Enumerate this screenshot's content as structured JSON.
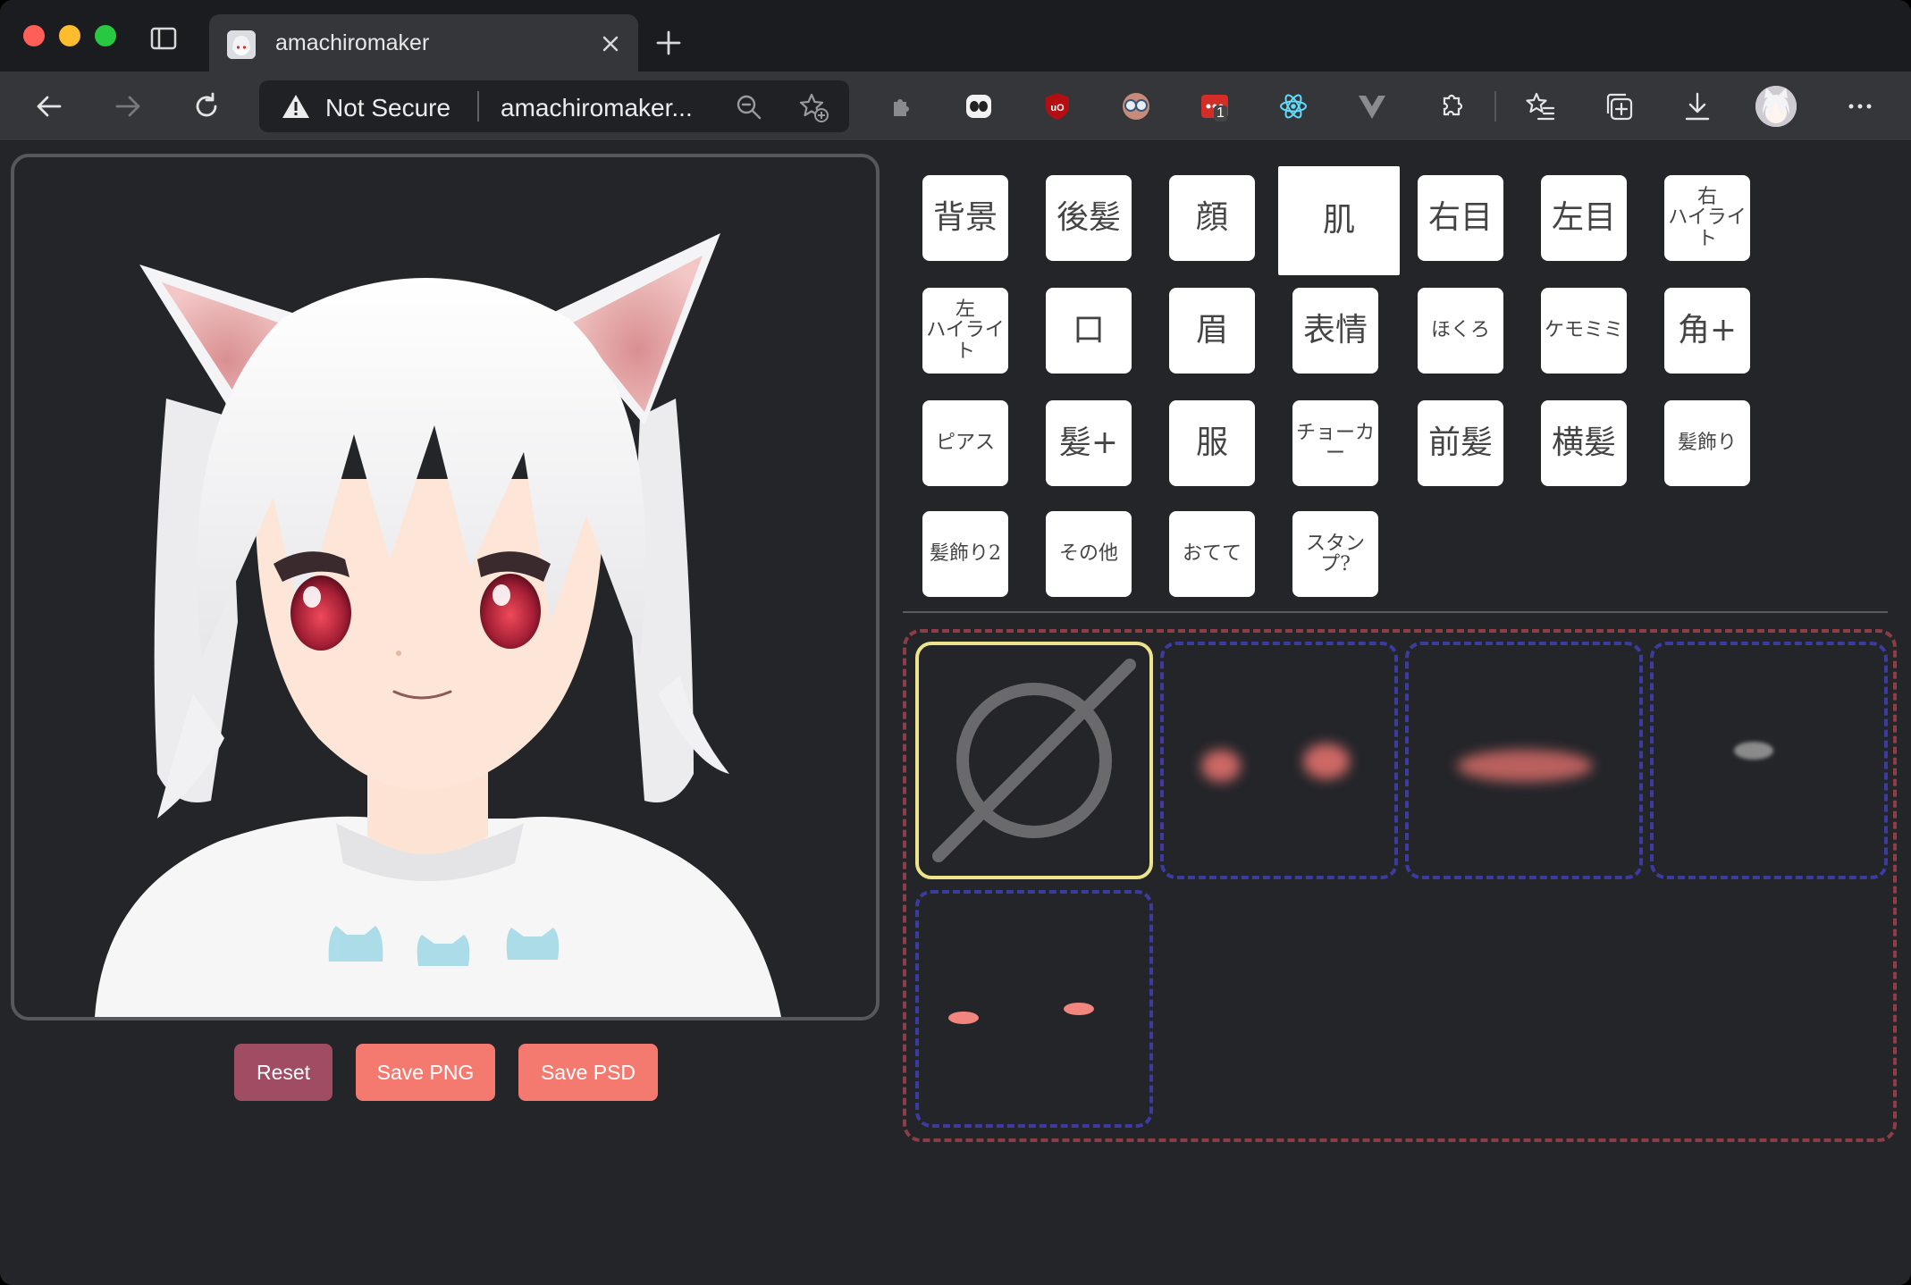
{
  "browser": {
    "tab": {
      "title": "amachiromaker"
    },
    "address": {
      "security": "Not Secure",
      "url": "amachiromaker..."
    },
    "extensions_badge": "1"
  },
  "actions": {
    "reset_label": "Reset",
    "save_png_label": "Save PNG",
    "save_psd_label": "Save PSD"
  },
  "categories": [
    {
      "label": "背景"
    },
    {
      "label": "後髪"
    },
    {
      "label": "顔"
    },
    {
      "label": "肌",
      "selected": true
    },
    {
      "label": "右目"
    },
    {
      "label": "左目"
    },
    {
      "label": "右\nハイライト"
    },
    {
      "label": "左\nハイライト"
    },
    {
      "label": "口"
    },
    {
      "label": "眉"
    },
    {
      "label": "表情"
    },
    {
      "label": "ほくろ"
    },
    {
      "label": "ケモミミ"
    },
    {
      "label": "角+"
    },
    {
      "label": "ピアス"
    },
    {
      "label": "髪+"
    },
    {
      "label": "服"
    },
    {
      "label": "チョーカー"
    },
    {
      "label": "前髪"
    },
    {
      "label": "横髪"
    },
    {
      "label": "髪飾り"
    },
    {
      "label": "髪飾り2"
    },
    {
      "label": "その他"
    },
    {
      "label": "おてて"
    },
    {
      "label": "スタンプ?"
    }
  ],
  "options": [
    {
      "name": "none",
      "selected": true
    },
    {
      "name": "blush-round"
    },
    {
      "name": "blush-band"
    },
    {
      "name": "mole"
    },
    {
      "name": "blush-small"
    }
  ],
  "colors": {
    "accent_reset": "#a04c63",
    "accent_save": "#f47a70",
    "selected_border": "#ece38a",
    "cell_border": "#3d3aa0",
    "group_border": "#8c3d45"
  }
}
